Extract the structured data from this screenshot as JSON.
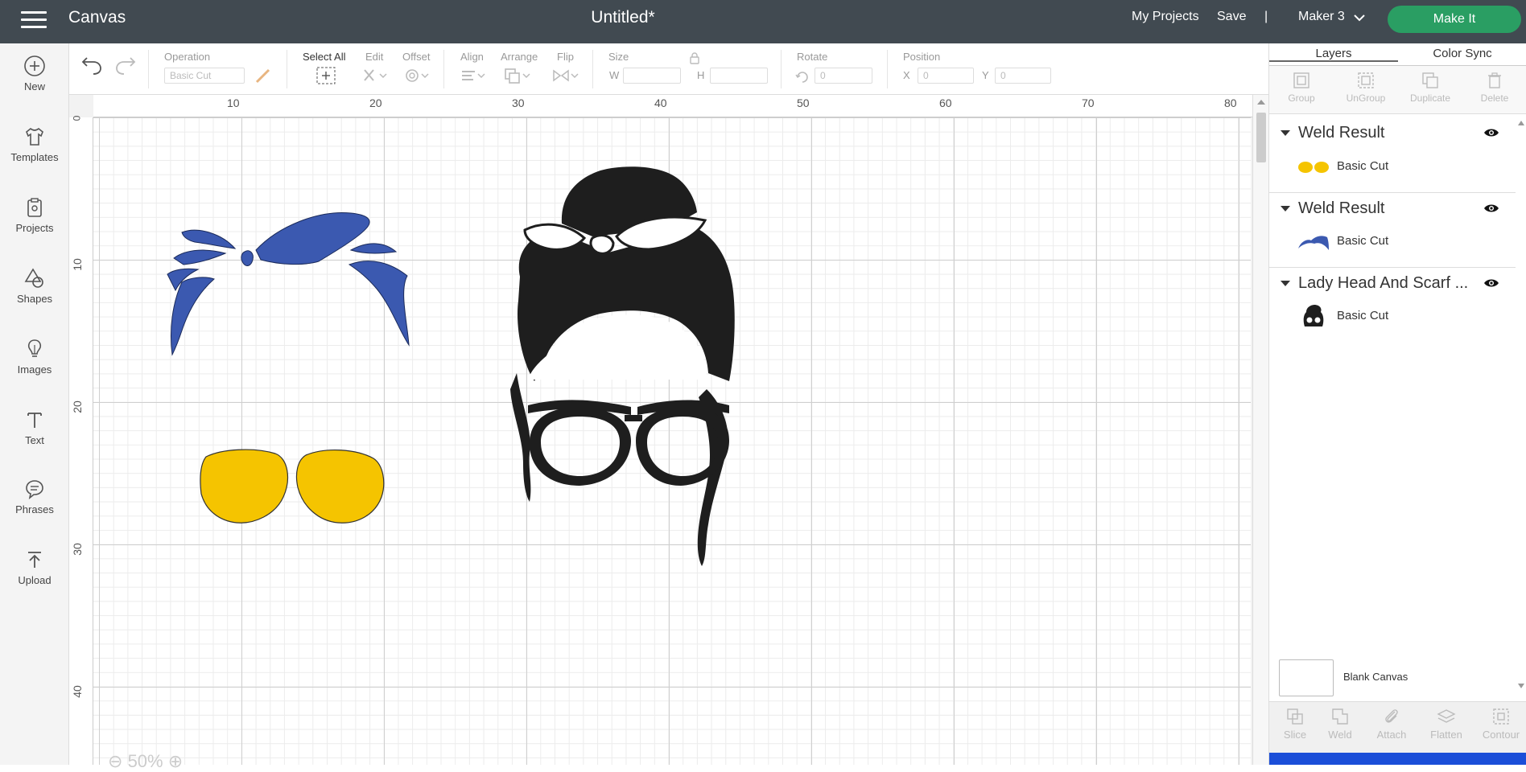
{
  "header": {
    "app_title": "Canvas",
    "doc_title": "Untitled*",
    "my_projects": "My Projects",
    "save": "Save",
    "divider": "|",
    "machine": "Maker 3",
    "make_it": "Make It"
  },
  "sidebar": {
    "items": [
      {
        "label": "New",
        "icon": "plus-circle-icon"
      },
      {
        "label": "Templates",
        "icon": "tshirt-icon"
      },
      {
        "label": "Projects",
        "icon": "projects-icon"
      },
      {
        "label": "Shapes",
        "icon": "shapes-icon"
      },
      {
        "label": "Images",
        "icon": "lightbulb-icon"
      },
      {
        "label": "Text",
        "icon": "text-icon"
      },
      {
        "label": "Phrases",
        "icon": "speech-bubble-icon"
      },
      {
        "label": "Upload",
        "icon": "upload-icon"
      }
    ]
  },
  "toolbar": {
    "operation_label": "Operation",
    "operation_value": "Basic Cut",
    "select_all": "Select All",
    "edit": "Edit",
    "offset": "Offset",
    "align": "Align",
    "arrange": "Arrange",
    "flip": "Flip",
    "size": "Size",
    "w": "W",
    "h": "H",
    "rotate": "Rotate",
    "rotate_value": "0",
    "position": "Position",
    "x": "X",
    "x_value": "0",
    "y": "Y",
    "y_value": "0"
  },
  "canvas": {
    "ruler_top": [
      "10",
      "20",
      "30",
      "40",
      "50",
      "60",
      "70",
      "80"
    ],
    "ruler_left": [
      "0",
      "10",
      "20",
      "30",
      "40"
    ],
    "zoom": "50%"
  },
  "panel": {
    "tabs": [
      "Layers",
      "Color Sync"
    ],
    "actions": [
      "Group",
      "UnGroup",
      "Duplicate",
      "Delete"
    ],
    "groups": [
      {
        "name": "Weld Result",
        "layer": "Basic Cut",
        "thumb": "glasses"
      },
      {
        "name": "Weld Result",
        "layer": "Basic Cut",
        "thumb": "scarf"
      },
      {
        "name": "Lady Head And Scarf ...",
        "layer": "Basic Cut",
        "thumb": "head"
      }
    ],
    "blank_canvas": "Blank Canvas",
    "bottom_actions": [
      "Slice",
      "Weld",
      "Attach",
      "Flatten",
      "Contour"
    ]
  },
  "colors": {
    "topbar": "#414a51",
    "make_it": "#2a9e63",
    "scarf_blue": "#3b59b0",
    "glasses_yellow": "#f5c400",
    "head_black": "#1e1e1e"
  }
}
